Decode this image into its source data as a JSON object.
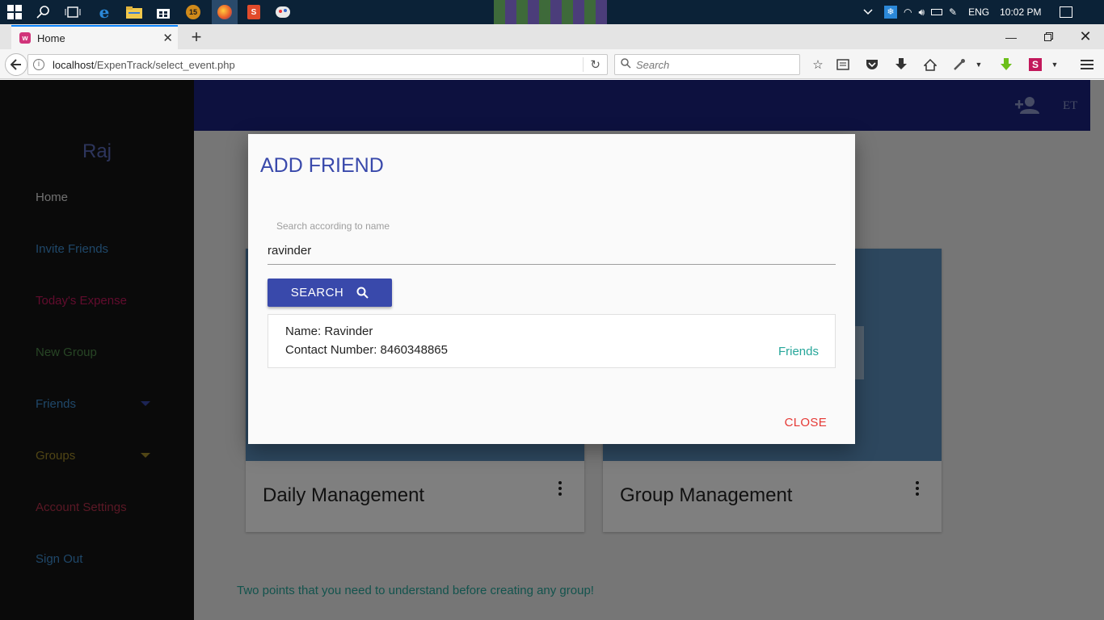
{
  "taskbar": {
    "tray": {
      "language": "ENG",
      "time": "10:02 PM"
    },
    "pinned": [
      "start-icon",
      "search-icon",
      "task-view-icon",
      "edge-icon",
      "file-explorer-icon",
      "store-icon",
      "app-15-icon",
      "firefox-icon",
      "app-red-icon",
      "paint-icon"
    ]
  },
  "browser": {
    "tab_title": "Home",
    "url_host": "localhost",
    "url_path": "/ExpenTrack/select_event.php",
    "search_placeholder": "Search"
  },
  "sidebar": {
    "user_name": "Raj",
    "items": [
      {
        "label": "Home",
        "color": "#e0e0e0"
      },
      {
        "label": "Invite Friends",
        "color": "#3f8fd2"
      },
      {
        "label": "Today's Expense",
        "color": "#c2185b"
      },
      {
        "label": "New Group",
        "color": "#4f8a4a"
      },
      {
        "label": "Friends",
        "color": "#3f8fd2",
        "has_dropdown": true
      },
      {
        "label": "Groups",
        "color": "#a08a2a",
        "has_dropdown": true
      },
      {
        "label": "Account Settings",
        "color": "#b5304a"
      },
      {
        "label": "Sign Out",
        "color": "#3f8fd2"
      }
    ]
  },
  "appbar": {
    "brand": "ET",
    "icon": "person-add-icon"
  },
  "cards": [
    {
      "title": "Daily Management"
    },
    {
      "title": "Group Management"
    }
  ],
  "footer_note": "Two points that you need to understand before creating any group!",
  "modal": {
    "title": "ADD FRIEND",
    "field_label": "Search according to name",
    "field_value": "ravinder",
    "search_button": "SEARCH",
    "result": {
      "name_line": "Name: Ravinder",
      "contact_line": "Contact Number: 8460348865",
      "status": "Friends"
    },
    "close_button": "CLOSE"
  },
  "colors": {
    "primary": "#3949ab",
    "appbar": "#1a237e",
    "teal": "#26a69a",
    "danger": "#e53935"
  }
}
